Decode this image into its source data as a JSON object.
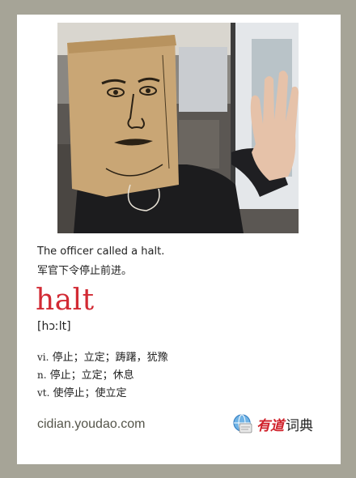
{
  "card": {
    "example_en": "The officer called a halt.",
    "example_zh": "军官下令停止前进。",
    "headword": "halt",
    "phonetic": "[hɔːlt]",
    "definitions": [
      {
        "pos": "vi.",
        "meaning": " 停止；立定；踌躇，犹豫"
      },
      {
        "pos": "n.",
        "meaning": " 停止；立定；休息"
      },
      {
        "pos": "vt.",
        "meaning": " 使停止；使立定"
      }
    ],
    "site": "cidian.youdao.com",
    "logo": {
      "brand": "有道",
      "dict": "词典",
      "icon": "youdao-globe-icon"
    },
    "headword_color": "#d22a34"
  }
}
